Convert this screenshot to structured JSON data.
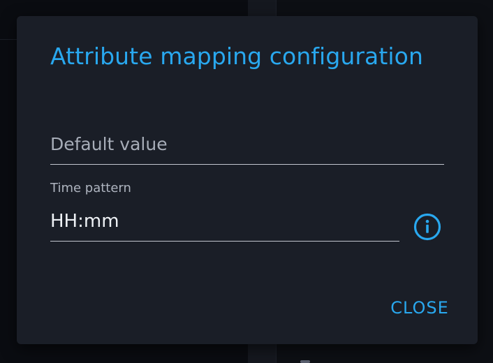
{
  "dialog": {
    "title": "Attribute mapping configuration",
    "default_value": {
      "placeholder": "Default value",
      "value": ""
    },
    "time_pattern": {
      "label": "Time pattern",
      "value": "HH:mm"
    },
    "info_icon": "info-circle-icon",
    "close_label": "CLOSE"
  },
  "colors": {
    "accent": "#29a8ef",
    "dialog_background": "#1a1e27",
    "page_background": "#07090d"
  }
}
